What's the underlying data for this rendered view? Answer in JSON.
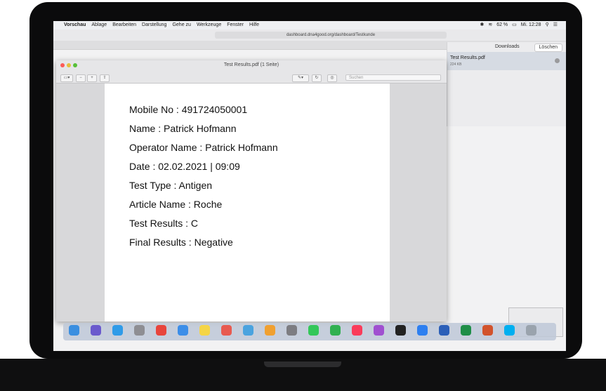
{
  "menubar": {
    "apple_icon": "",
    "app_name": "Vorschau",
    "items": [
      "Ablage",
      "Bearbeiten",
      "Darstellung",
      "Gehe zu",
      "Werkzeuge",
      "Fenster",
      "Hilfe"
    ],
    "battery": "62 %",
    "clock": "Mi. 12:28"
  },
  "safari": {
    "url": "dashboard.dna4good.org/dashboard/Testkunde"
  },
  "downloads": {
    "title": "Downloads",
    "clear_label": "Löschen",
    "item_name": "Test Results.pdf",
    "item_size": "224 KB"
  },
  "preview": {
    "window_title": "Test Results.pdf (1 Seite)",
    "search_placeholder": "Suchen",
    "lines": [
      "Mobile No : 491724050001",
      "Name : Patrick Hofmann",
      "Operator Name : Patrick Hofmann",
      "Date : 02.02.2021 | 09:09",
      "Test Type : Antigen",
      "Article Name : Roche",
      "Test Results : C",
      "Final Results : Negative"
    ]
  },
  "colors": {
    "close": "#fc5b57",
    "minimize": "#e5bf3c",
    "maximize": "#57c038",
    "laptop": "#0b0b0c",
    "selection": "#d6dbe3"
  },
  "dock": {
    "icons": [
      "finder-icon",
      "siri-icon",
      "safari-icon",
      "rocket-icon",
      "chrome-icon",
      "mail-icon",
      "notes-icon",
      "calendar-icon",
      "preview-icon",
      "photos-icon",
      "settings-icon",
      "messages-icon",
      "facetime-icon",
      "music-icon",
      "podcasts-icon",
      "tv-icon",
      "app-store-icon",
      "word-icon",
      "excel-icon",
      "powerpoint-icon",
      "skype-icon",
      "trash-icon"
    ]
  }
}
